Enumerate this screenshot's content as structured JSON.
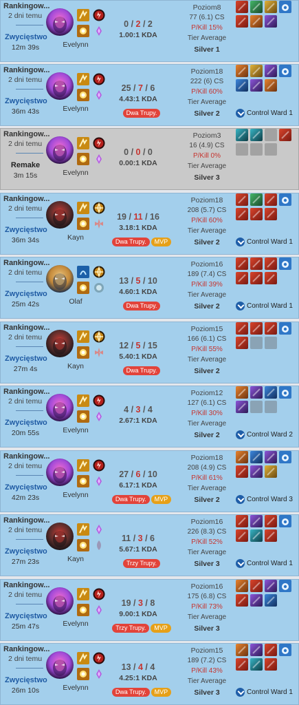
{
  "colors": {
    "win_bg": "#a3cfec",
    "remake_bg": "#c9c9c9",
    "death_red": "#c6342f",
    "badge_red": "#e2433a",
    "badge_gold": "#e6a018"
  },
  "matches": [
    {
      "mode": "Rankingow...",
      "time_ago": "2 dni temu",
      "result": "Zwycięstwo",
      "duration": "12m 39s",
      "champion": "Evelynn",
      "spell1": "smite",
      "spell2": "flash",
      "rune1": "electrocute",
      "rune2": "domination",
      "kills": "0",
      "deaths": "2",
      "assists": "2",
      "kda": "1.00:1 KDA",
      "badges": [],
      "level": "Poziom8",
      "cs": "77 (6.1) CS",
      "pkill": "P/Kill 15%",
      "tier_label": "Tier Average",
      "tier": "Silver 1",
      "items": [
        "red",
        "green",
        "gold",
        "red",
        "orange",
        "violet",
        "ward-blue"
      ],
      "control_ward": ""
    },
    {
      "mode": "Rankingow...",
      "time_ago": "2 dni temu",
      "result": "Zwycięstwo",
      "duration": "36m 43s",
      "champion": "Evelynn",
      "spell1": "smite",
      "spell2": "flash",
      "rune1": "electrocute",
      "rune2": "domination",
      "kills": "25",
      "deaths": "7",
      "assists": "6",
      "kda": "4.43:1 KDA",
      "badges": [
        {
          "t": "Dwa Trupy.",
          "k": "multi"
        }
      ],
      "level": "Poziom18",
      "cs": "222 (6) CS",
      "pkill": "P/Kill 60%",
      "tier_label": "Tier Average",
      "tier": "Silver 2",
      "items": [
        "orange",
        "gold",
        "violet",
        "blue",
        "violet",
        "orange",
        "ward-blue"
      ],
      "control_ward": "Control Ward 1"
    },
    {
      "mode": "Rankingow...",
      "time_ago": "2 dni temu",
      "result": "Remake",
      "duration": "3m 15s",
      "champion": "Evelynn",
      "spell1": "smite",
      "spell2": "flash",
      "rune1": "electrocute",
      "rune2": "domination",
      "kills": "0",
      "deaths": "0",
      "assists": "0",
      "kda": "0.00:1 KDA",
      "badges": [],
      "level": "Poziom3",
      "cs": "16 (4.9) CS",
      "pkill": "P/Kill 0%",
      "tier_label": "Tier Average",
      "tier": "Silver 3",
      "items": [
        "teal",
        "teal",
        "empty",
        "empty",
        "empty",
        "empty",
        "red"
      ],
      "control_ward": "",
      "remake": true
    },
    {
      "mode": "Rankingow...",
      "time_ago": "2 dni temu",
      "result": "Zwycięstwo",
      "duration": "36m 34s",
      "champion": "Kayn",
      "spell1": "smite",
      "spell2": "flash",
      "rune1": "conqueror",
      "rune2": "precision",
      "kills": "19",
      "deaths": "11",
      "assists": "16",
      "kda": "3.18:1 KDA",
      "badges": [
        {
          "t": "Dwa Trupy.",
          "k": "multi"
        },
        {
          "t": "MVP",
          "k": "mvp"
        }
      ],
      "level": "Poziom18",
      "cs": "208 (5.7) CS",
      "pkill": "P/Kill 60%",
      "tier_label": "Tier Average",
      "tier": "Silver 2",
      "items": [
        "red",
        "green",
        "red",
        "red",
        "red",
        "red",
        "ward-blue"
      ],
      "control_ward": "Control Ward 1"
    },
    {
      "mode": "Rankingow...",
      "time_ago": "2 dni temu",
      "result": "Zwycięstwo",
      "duration": "25m 42s",
      "champion": "Olaf",
      "spell1": "blue",
      "spell2": "flash",
      "rune1": "conqueror",
      "rune2": "resolve",
      "kills": "13",
      "deaths": "5",
      "assists": "10",
      "kda": "4.60:1 KDA",
      "badges": [
        {
          "t": "Dwa Trupy.",
          "k": "multi"
        }
      ],
      "level": "Poziom16",
      "cs": "189 (7.4) CS",
      "pkill": "P/Kill 39%",
      "tier_label": "Tier Average",
      "tier": "Silver 2",
      "items": [
        "red",
        "red",
        "red",
        "red",
        "red",
        "red",
        "ward-blue"
      ],
      "control_ward": "Control Ward 1"
    },
    {
      "mode": "Rankingow...",
      "time_ago": "2 dni temu",
      "result": "Zwycięstwo",
      "duration": "27m 4s",
      "champion": "Kayn",
      "spell1": "smite",
      "spell2": "flash",
      "rune1": "conqueror",
      "rune2": "precision",
      "kills": "12",
      "deaths": "5",
      "assists": "15",
      "kda": "5.40:1 KDA",
      "badges": [
        {
          "t": "Dwa Trupy.",
          "k": "multi"
        }
      ],
      "level": "Poziom15",
      "cs": "166 (6.1) CS",
      "pkill": "P/Kill 55%",
      "tier_label": "Tier Average",
      "tier": "Silver 2",
      "items": [
        "red",
        "red",
        "red",
        "red",
        "empty",
        "empty",
        "ward-blue"
      ],
      "control_ward": ""
    },
    {
      "mode": "Rankingow...",
      "time_ago": "2 dni temu",
      "result": "Zwycięstwo",
      "duration": "20m 55s",
      "champion": "Evelynn",
      "spell1": "smite",
      "spell2": "flash",
      "rune1": "electrocute",
      "rune2": "domination",
      "kills": "4",
      "deaths": "3",
      "assists": "4",
      "kda": "2.67:1 KDA",
      "badges": [],
      "level": "Poziom12",
      "cs": "127 (6.1) CS",
      "pkill": "P/Kill 30%",
      "tier_label": "Tier Average",
      "tier": "Silver 2",
      "items": [
        "orange",
        "violet",
        "blue",
        "violet",
        "empty",
        "empty",
        "ward-blue"
      ],
      "control_ward": "Control Ward 2"
    },
    {
      "mode": "Rankingow...",
      "time_ago": "2 dni temu",
      "result": "Zwycięstwo",
      "duration": "42m 23s",
      "champion": "Evelynn",
      "spell1": "smite",
      "spell2": "flash",
      "rune1": "electrocute",
      "rune2": "domination",
      "kills": "27",
      "deaths": "6",
      "assists": "10",
      "kda": "6.17:1 KDA",
      "badges": [
        {
          "t": "Dwa Trupy.",
          "k": "multi"
        },
        {
          "t": "MVP",
          "k": "mvp"
        }
      ],
      "level": "Poziom18",
      "cs": "208 (4.9) CS",
      "pkill": "P/Kill 61%",
      "tier_label": "Tier Average",
      "tier": "Silver 2",
      "items": [
        "orange",
        "blue",
        "violet",
        "red",
        "violet",
        "gold",
        "ward-blue"
      ],
      "control_ward": "Control Ward 3"
    },
    {
      "mode": "Rankingow...",
      "time_ago": "2 dni temu",
      "result": "Zwycięstwo",
      "duration": "27m 23s",
      "champion": "Kayn",
      "spell1": "smite",
      "spell2": "flash",
      "rune1": "domination",
      "rune2": "sorcery",
      "kills": "11",
      "deaths": "3",
      "assists": "6",
      "kda": "5.67:1 KDA",
      "badges": [
        {
          "t": "Trzy Trupy.",
          "k": "multi"
        }
      ],
      "level": "Poziom16",
      "cs": "226 (8.3) CS",
      "pkill": "P/Kill 52%",
      "tier_label": "Tier Average",
      "tier": "Silver 3",
      "items": [
        "red",
        "violet",
        "red",
        "red",
        "teal",
        "red",
        "ward-blue"
      ],
      "control_ward": "Control Ward 1"
    },
    {
      "mode": "Rankingow...",
      "time_ago": "2 dni temu",
      "result": "Zwycięstwo",
      "duration": "25m 47s",
      "champion": "Evelynn",
      "spell1": "smite",
      "spell2": "flash",
      "rune1": "electrocute",
      "rune2": "domination",
      "kills": "19",
      "deaths": "3",
      "assists": "8",
      "kda": "9.00:1 KDA",
      "badges": [
        {
          "t": "Trzy Trupy.",
          "k": "multi"
        },
        {
          "t": "MVP",
          "k": "mvp"
        }
      ],
      "level": "Poziom16",
      "cs": "175 (6.8) CS",
      "pkill": "P/Kill 73%",
      "tier_label": "Tier Average",
      "tier": "Silver 3",
      "items": [
        "orange",
        "red",
        "violet",
        "red",
        "violet",
        "blue",
        "ward-blue"
      ],
      "control_ward": ""
    },
    {
      "mode": "Rankingow...",
      "time_ago": "2 dni temu",
      "result": "Zwycięstwo",
      "duration": "26m 10s",
      "champion": "Evelynn",
      "spell1": "smite",
      "spell2": "flash",
      "rune1": "electrocute",
      "rune2": "domination",
      "kills": "13",
      "deaths": "4",
      "assists": "4",
      "kda": "4.25:1 KDA",
      "badges": [
        {
          "t": "Dwa Trupy.",
          "k": "multi"
        },
        {
          "t": "MVP",
          "k": "mvp"
        }
      ],
      "level": "Poziom15",
      "cs": "189 (7.2) CS",
      "pkill": "P/Kill 43%",
      "tier_label": "Tier Average",
      "tier": "Silver 3",
      "items": [
        "orange",
        "violet",
        "red",
        "red",
        "teal",
        "red",
        "ward-blue"
      ],
      "control_ward": "Control Ward 1"
    }
  ]
}
